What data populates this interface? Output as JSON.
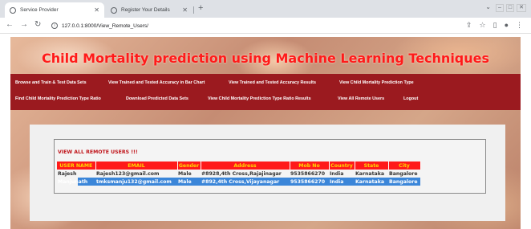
{
  "browser": {
    "tabs": [
      {
        "title": "Service Provider",
        "active": true
      },
      {
        "title": "Register Your Details",
        "active": false
      }
    ],
    "url": "127.0.0.1:8000/View_Remote_Users/"
  },
  "page": {
    "title": "Child Mortality prediction using Machine Learning Techniques",
    "nav_row1": [
      "Browse and Train & Test Data Sets",
      "View Trained and Tested Accuracy in Bar Chart",
      "View Trained and Tested Accuracy Results",
      "View Child Mortality Prediction Type"
    ],
    "nav_row2": [
      "Find Child Mortality Prediction Type Ratio",
      "Download Predicted Data Sets",
      "View Child Mortality Prediction Type Ratio Results",
      "View All Remote Users",
      "Logout"
    ],
    "heading": "VIEW ALL REMOTE USERS !!!",
    "table": {
      "headers": [
        "USER NAME",
        "EMAIL",
        "Gender",
        "Address",
        "Mob No",
        "Country",
        "State",
        "City"
      ],
      "rows": [
        [
          "Rajesh",
          "Rajesh123@gmail.com",
          "Male",
          "#8928,4th Cross,Rajajinagar",
          "9535866270",
          "India",
          "Karnataka",
          "Bangalore"
        ],
        [
          "Manjunath",
          "tmksmanju132@gmail.com",
          "Male",
          "#892,4th Cross,Vijayanagar",
          "9535866270",
          "India",
          "Karnataka",
          "Bangalore"
        ]
      ]
    }
  },
  "colors": {
    "nav_bg": "#9b1a1f",
    "title": "#ff1a1a",
    "header_bg": "#ff1a1a",
    "header_text": "#ffd800",
    "selection": "#3b86d9"
  }
}
